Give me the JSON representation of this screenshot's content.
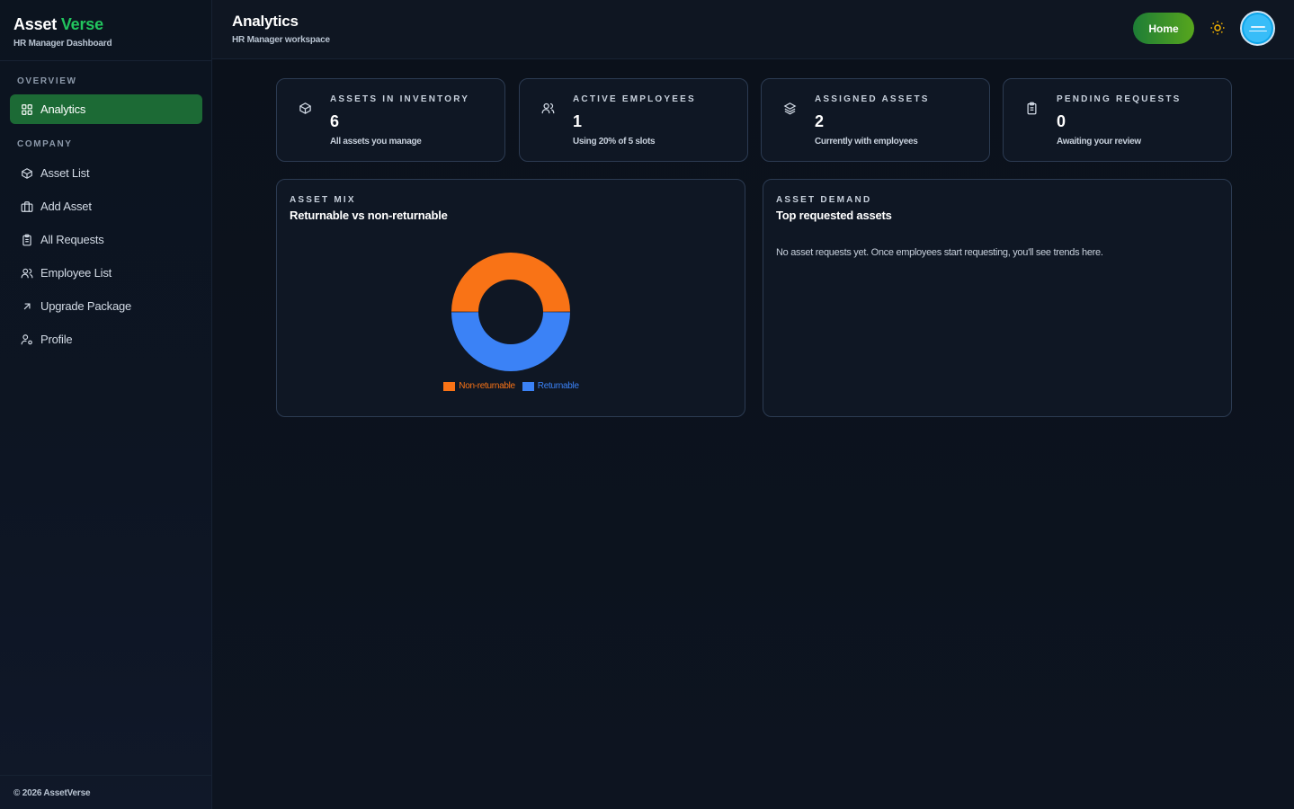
{
  "brand": {
    "name_part1": "Asset ",
    "name_part2": "Verse",
    "subtitle": "HR Manager Dashboard"
  },
  "sidebar": {
    "sections": [
      {
        "label": "OVERVIEW"
      },
      {
        "label": "COMPANY"
      }
    ],
    "items": [
      {
        "label": "Analytics",
        "icon": "grid-icon",
        "active": true
      },
      {
        "label": "Asset List",
        "icon": "box-icon"
      },
      {
        "label": "Add Asset",
        "icon": "briefcase-icon"
      },
      {
        "label": "All Requests",
        "icon": "clipboard-icon"
      },
      {
        "label": "Employee List",
        "icon": "users-icon"
      },
      {
        "label": "Upgrade Package",
        "icon": "arrow-up-right-icon"
      },
      {
        "label": "Profile",
        "icon": "user-cog-icon"
      }
    ],
    "footer": "© 2026 AssetVerse"
  },
  "header": {
    "title": "Analytics",
    "subtitle": "HR Manager workspace",
    "home_label": "Home",
    "theme_icon": "sun-icon"
  },
  "stats": [
    {
      "label": "ASSETS IN INVENTORY",
      "value": "6",
      "note": "All assets you manage",
      "icon": "box-icon"
    },
    {
      "label": "ACTIVE EMPLOYEES",
      "value": "1",
      "note": "Using 20% of 5 slots",
      "icon": "users-icon"
    },
    {
      "label": "ASSIGNED ASSETS",
      "value": "2",
      "note": "Currently with employees",
      "icon": "layers-icon"
    },
    {
      "label": "PENDING REQUESTS",
      "value": "0",
      "note": "Awaiting your review",
      "icon": "clipboard-icon"
    }
  ],
  "asset_mix": {
    "label": "ASSET MIX",
    "title": "Returnable vs non-returnable"
  },
  "asset_demand": {
    "label": "ASSET DEMAND",
    "title": "Top requested assets",
    "empty_message": "No asset requests yet. Once employees start requesting, you'll see trends here."
  },
  "colors": {
    "accent": "#22c55e",
    "non_returnable": "#f97316",
    "returnable": "#3b82f6"
  },
  "chart_data": {
    "type": "pie",
    "categories": [
      "Non-returnable",
      "Returnable"
    ],
    "values": [
      3,
      3
    ],
    "colors": [
      "#f97316",
      "#3b82f6"
    ],
    "title": "",
    "legend": "bottom"
  }
}
